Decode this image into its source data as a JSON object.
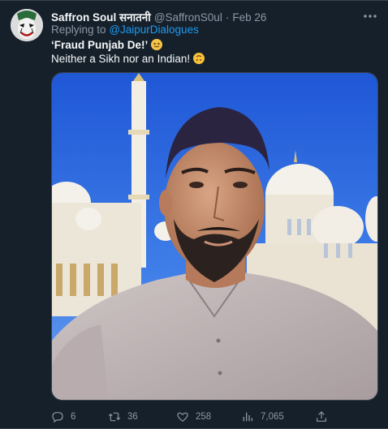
{
  "tweet": {
    "display_name": "Saffron Soul सनातनी",
    "handle": "@SaffronS0ul",
    "separator": "·",
    "timestamp": "Feb 26",
    "more_icon": "more-horizontal-icon",
    "reply_prefix": "Replying to",
    "reply_to": "@JaipurDialogues",
    "line1": "‘Fraud Punjab De!’",
    "line2": "Neither a Sikh nor an Indian!",
    "emoji1": "confounded-face-emoji",
    "emoji2": "upside-down-face-emoji"
  },
  "actions": {
    "reply_count": "6",
    "retweet_count": "36",
    "like_count": "258",
    "views_count": "7,065"
  },
  "colors": {
    "background": "#15202b",
    "text": "#f7f9f9",
    "secondary": "#8b98a5",
    "link": "#1d9bf0",
    "border": "#38444d"
  }
}
